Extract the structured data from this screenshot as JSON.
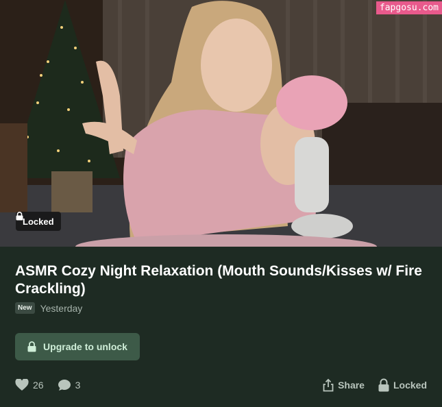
{
  "watermark": "fapgosu.com",
  "thumbnail": {
    "lock_label": "Locked"
  },
  "post": {
    "title": "ASMR Cozy Night Relaxation (Mouth Sounds/Kisses w/ Fire Crackling)",
    "badge": "New",
    "time": "Yesterday"
  },
  "upgrade": {
    "label": "Upgrade to unlock"
  },
  "footer": {
    "likes": "26",
    "comments": "3",
    "share_label": "Share",
    "locked_label": "Locked"
  },
  "colors": {
    "background": "#1e2b23",
    "button": "#3d5a48",
    "button_text": "#cfeed8",
    "watermark": "#e85a8c"
  },
  "icons": [
    "lock-icon",
    "heart-icon",
    "comment-icon",
    "share-icon"
  ]
}
